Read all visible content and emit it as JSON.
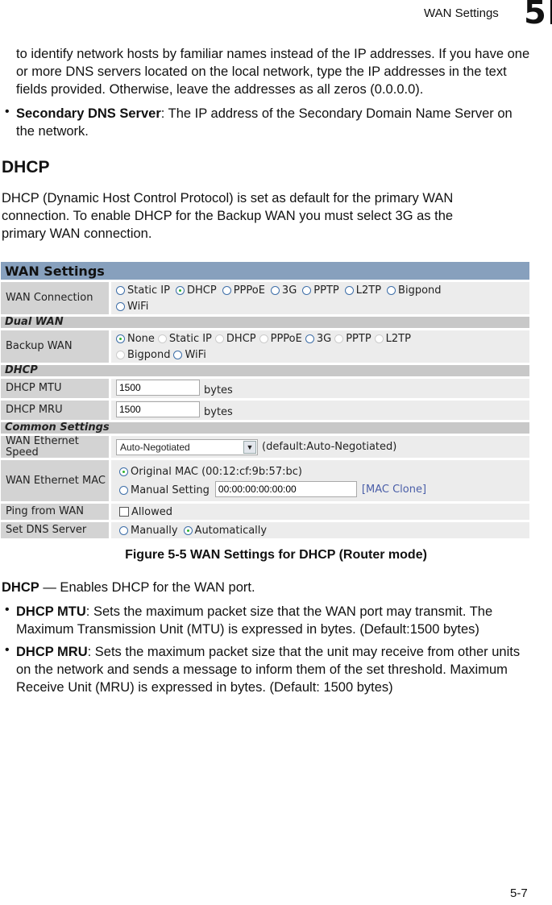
{
  "header": {
    "section_title": "WAN Settings",
    "chapter_number": "5"
  },
  "intro": {
    "paragraph": "to identify network hosts by familiar names instead of the IP addresses. If you have one or more DNS servers located on the local network, type the IP addresses in the text fields provided. Otherwise, leave the addresses as all zeros (0.0.0.0).",
    "bullet_term": "Secondary DNS Server",
    "bullet_text": ": The IP address of the Secondary Domain Name Server on the network."
  },
  "dhcp_section": {
    "heading": "DHCP",
    "paragraph": "DHCP (Dynamic Host Control Protocol) is set as default for the primary WAN connection. To enable DHCP for the Backup WAN you must select 3G as the primary WAN connection."
  },
  "figure": {
    "title": "WAN Settings",
    "wan_connection": {
      "label": "WAN Connection",
      "options": [
        {
          "label": "Static IP",
          "selected": false
        },
        {
          "label": "DHCP",
          "selected": true
        },
        {
          "label": "PPPoE",
          "selected": false
        },
        {
          "label": "3G",
          "selected": false
        },
        {
          "label": "PPTP",
          "selected": false
        },
        {
          "label": "L2TP",
          "selected": false
        },
        {
          "label": "Bigpond",
          "selected": false
        },
        {
          "label": "WiFi",
          "selected": false
        }
      ]
    },
    "dual_wan_header": "Dual WAN",
    "backup_wan": {
      "label": "Backup WAN",
      "options": [
        {
          "label": "None",
          "selected": true,
          "enabled": true
        },
        {
          "label": "Static IP",
          "selected": false,
          "enabled": false
        },
        {
          "label": "DHCP",
          "selected": false,
          "enabled": false
        },
        {
          "label": "PPPoE",
          "selected": false,
          "enabled": false
        },
        {
          "label": "3G",
          "selected": false,
          "enabled": true
        },
        {
          "label": "PPTP",
          "selected": false,
          "enabled": false
        },
        {
          "label": "L2TP",
          "selected": false,
          "enabled": false
        },
        {
          "label": "Bigpond",
          "selected": false,
          "enabled": false
        },
        {
          "label": "WiFi",
          "selected": false,
          "enabled": true
        }
      ]
    },
    "dhcp_header": "DHCP",
    "dhcp_mtu": {
      "label": "DHCP MTU",
      "value": "1500",
      "unit": "bytes"
    },
    "dhcp_mru": {
      "label": "DHCP MRU",
      "value": "1500",
      "unit": "bytes"
    },
    "common_header": "Common Settings",
    "eth_speed": {
      "label": "WAN Ethernet Speed",
      "selected": "Auto-Negotiated",
      "note": "(default:Auto-Negotiated)"
    },
    "eth_mac": {
      "label": "WAN Ethernet MAC",
      "original_label": "Original MAC (00:12:cf:9b:57:bc)",
      "original_selected": true,
      "manual_label": "Manual Setting",
      "manual_value": "00:00:00:00:00:00",
      "clone_link": "[MAC Clone]"
    },
    "ping": {
      "label": "Ping from WAN",
      "checkbox_label": "Allowed",
      "checked": false
    },
    "dns": {
      "label": "Set DNS Server",
      "manual_label": "Manually",
      "auto_label": "Automatically",
      "auto_selected": true
    }
  },
  "caption": "Figure 5-5  WAN Settings for DHCP (Router mode)",
  "details": {
    "lead_term": "DHCP",
    "lead_text": " — Enables  DHCP for the WAN port.",
    "bullets": [
      {
        "term": "DHCP MTU",
        "text": ": Sets the maximum packet size that the WAN port may transmit. The Maximum Transmission Unit (MTU) is expressed in bytes. (Default:1500 bytes)"
      },
      {
        "term": "DHCP MRU",
        "text": ": Sets the maximum packet size that the unit may receive from other units on the network and sends a message to inform them of the set threshold. Maximum Receive Unit (MRU) is expressed in bytes. (Default: 1500 bytes)"
      }
    ]
  },
  "footer": {
    "page_number": "5-7"
  }
}
